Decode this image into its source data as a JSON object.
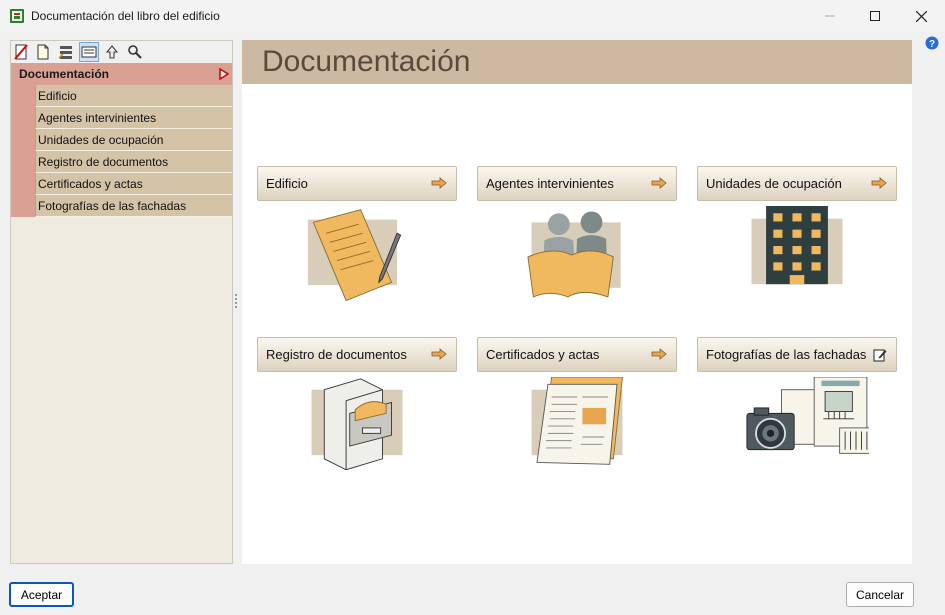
{
  "window": {
    "title": "Documentación del libro del edificio",
    "minimize": "minimize",
    "maximize": "maximize",
    "close": "close"
  },
  "toolbar": {
    "icons": [
      "no-document-icon",
      "new-document-icon",
      "list-icon",
      "form-view-icon",
      "upload-icon",
      "search-icon"
    ]
  },
  "tree": {
    "root": "Documentación",
    "items": [
      {
        "label": "Edificio"
      },
      {
        "label": "Agentes intervinientes"
      },
      {
        "label": "Unidades de ocupación"
      },
      {
        "label": "Registro de documentos"
      },
      {
        "label": "Certificados y actas"
      },
      {
        "label": "Fotografías de las fachadas"
      }
    ]
  },
  "main": {
    "title": "Documentación",
    "cards": [
      {
        "label": "Edificio",
        "icon": "arrow-right-icon",
        "picture": "signing-document-picture"
      },
      {
        "label": "Agentes intervinientes",
        "icon": "arrow-right-icon",
        "picture": "people-picture"
      },
      {
        "label": "Unidades de ocupación",
        "icon": "arrow-right-icon",
        "picture": "building-picture"
      },
      {
        "label": "Registro de documentos",
        "icon": "arrow-right-icon",
        "picture": "file-cabinet-picture"
      },
      {
        "label": "Certificados y actas",
        "icon": "arrow-right-icon",
        "picture": "certificate-picture"
      },
      {
        "label": "Fotografías de las fachadas",
        "icon": "edit-icon",
        "picture": "camera-facade-picture"
      }
    ]
  },
  "footer": {
    "ok": "Aceptar",
    "cancel": "Cancelar"
  },
  "colors": {
    "tree_root": "#d9a093",
    "tree_item": "#d4c3a7",
    "header": "#cdb9a1",
    "header_text": "#5a4a3a",
    "accent_orange": "#e8a550"
  }
}
